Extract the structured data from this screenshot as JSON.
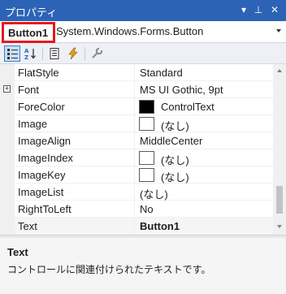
{
  "window": {
    "title": "プロパティ",
    "buttons": {
      "dropdown": "▾",
      "pin": "⊥",
      "close": "✕"
    }
  },
  "object_selector": {
    "name": "Button1",
    "type": "System.Windows.Forms.Button"
  },
  "toolbar": {
    "items": [
      "categorized-icon",
      "alphabetical-icon",
      "properties-icon",
      "events-icon",
      "property-pages-icon"
    ]
  },
  "properties": [
    {
      "name": "FlatStyle",
      "value": "Standard"
    },
    {
      "name": "Font",
      "value": "MS UI Gothic, 9pt",
      "expandable": true
    },
    {
      "name": "ForeColor",
      "value": "ControlText",
      "swatch": "#000000"
    },
    {
      "name": "Image",
      "value": "(なし)",
      "swatch": "#ffffff"
    },
    {
      "name": "ImageAlign",
      "value": "MiddleCenter"
    },
    {
      "name": "ImageIndex",
      "value": "(なし)",
      "swatch": "#ffffff"
    },
    {
      "name": "ImageKey",
      "value": "(なし)",
      "swatch": "#ffffff"
    },
    {
      "name": "ImageList",
      "value": "(なし)"
    },
    {
      "name": "RightToLeft",
      "value": "No"
    },
    {
      "name": "Text",
      "value": "Button1",
      "selected": true
    }
  ],
  "description": {
    "title": "Text",
    "text": "コントロールに関連付けられたテキストです。"
  },
  "colors": {
    "titlebar": "#2d63b6",
    "highlight_box": "#e21b1b",
    "accent": "#3c7fd6"
  }
}
